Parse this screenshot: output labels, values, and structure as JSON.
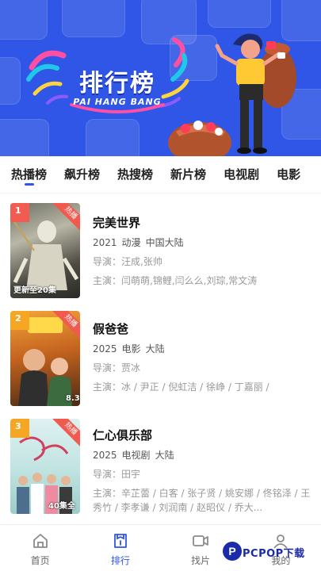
{
  "banner": {
    "title": "排行榜",
    "subtitle": "PAI HANG BANG"
  },
  "tabs": [
    {
      "label": "热播榜",
      "active": true
    },
    {
      "label": "飙升榜",
      "active": false
    },
    {
      "label": "热搜榜",
      "active": false
    },
    {
      "label": "新片榜",
      "active": false
    },
    {
      "label": "电视剧",
      "active": false
    },
    {
      "label": "电影",
      "active": false
    }
  ],
  "items": [
    {
      "rank": "1",
      "badge": "热播",
      "poster_caption": "更新至20集",
      "title": "完美世界",
      "year": "2021",
      "genre": "动漫",
      "region": "中国大陆",
      "director": "导演：汪成,张帅",
      "cast": "主演：闫萌萌,锦鲤,闫么么,刘琮,常文涛"
    },
    {
      "rank": "2",
      "badge": "热播",
      "poster_caption": "8.3",
      "title": "假爸爸",
      "year": "2025",
      "genre": "电影",
      "region": "大陆",
      "director": "导演：贾冰",
      "cast": "主演：冰 / 尹正 / 倪虹洁 / 徐峥 / 丁嘉丽 /"
    },
    {
      "rank": "3",
      "badge": "热播",
      "poster_caption": "40集全",
      "title": "仁心俱乐部",
      "year": "2025",
      "genre": "电视剧",
      "region": "大陆",
      "director": "导演：田宇",
      "cast": "主演：辛芷蕾 / 白客 / 张子贤 / 姚安娜 / 佟铭泽 / 王秀竹 / 李孝谦 / 刘润南 / 赵昭仪 / 乔大..."
    }
  ],
  "nav": [
    {
      "label": "首页",
      "icon": "home-icon",
      "active": false
    },
    {
      "label": "排行",
      "icon": "ranking-icon",
      "active": true
    },
    {
      "label": "找片",
      "icon": "video-icon",
      "active": false
    },
    {
      "label": "我的",
      "icon": "user-icon",
      "active": false
    }
  ],
  "watermark": {
    "text": "PCPOP下载",
    "logo": "P"
  },
  "colors": {
    "accent": "#2f56e6",
    "badge": "#f05a4f"
  }
}
